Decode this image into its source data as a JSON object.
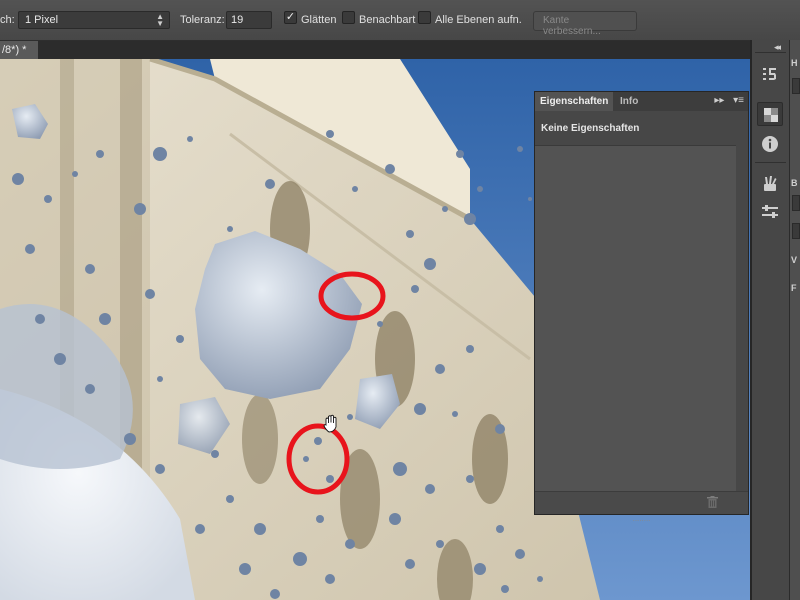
{
  "options_bar": {
    "prefix_label": "ch:",
    "size_select": "1 Pixel",
    "tolerance_label": "Toleranz:",
    "tolerance_value": "19",
    "smooth_label": "Glätten",
    "smooth_checked": true,
    "contiguous_label": "Benachbart",
    "contiguous_checked": false,
    "all_layers_label": "Alle Ebenen aufn.",
    "all_layers_checked": false,
    "refine_edge_label": "Kante verbessern..."
  },
  "document": {
    "tab_title": "/8*) *"
  },
  "properties_panel": {
    "tabs": [
      {
        "label": "Eigenschaften",
        "active": true
      },
      {
        "label": "Info",
        "active": false
      }
    ],
    "header_text": "Keine Eigenschaften",
    "menu_icons": [
      "expand-icon",
      "panel-menu-icon"
    ],
    "footer_icon": "trash-icon"
  },
  "dock": {
    "collapse_icon": "double-chevron-right-icon",
    "buttons": [
      "history-icon",
      "properties-icon",
      "info-icon",
      "brush-presets-icon",
      "adjust-icon"
    ]
  },
  "far_right": {
    "letters": [
      "H",
      "B",
      "V",
      "F"
    ]
  },
  "colors": {
    "interface_dark": "#2b2b2b",
    "panel": "#535353",
    "annotation_red": "#e8141c",
    "sky": "#4a78b8"
  }
}
